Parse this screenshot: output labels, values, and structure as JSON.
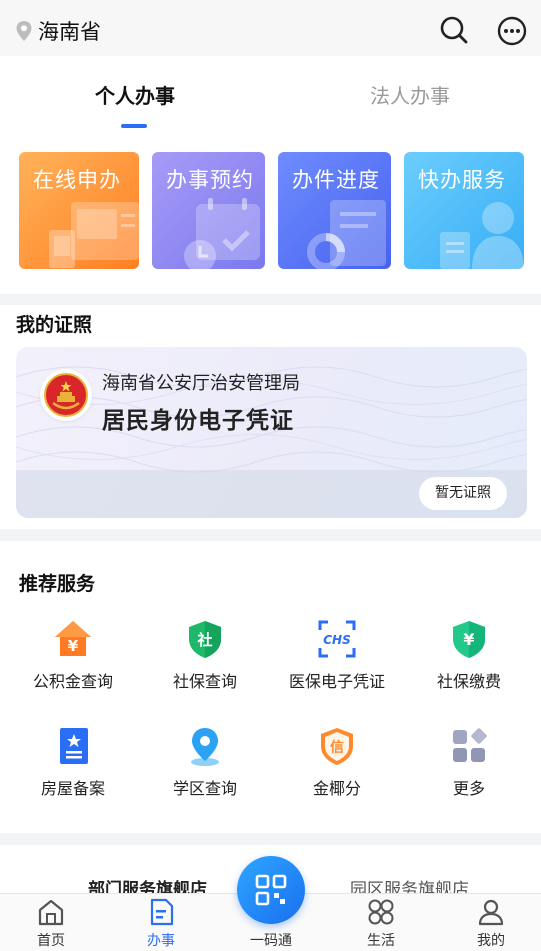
{
  "header": {
    "location": "海南省",
    "icons": {
      "location": "location-pin-icon",
      "search": "search-icon",
      "more": "more-icon"
    }
  },
  "tabs": [
    {
      "label": "个人办事",
      "active": true
    },
    {
      "label": "法人办事",
      "active": false
    }
  ],
  "quick_tiles": [
    {
      "label": "在线申办",
      "color": "#ff8a2b",
      "icon": "computer-icon"
    },
    {
      "label": "办事预约",
      "color": "#8a84f2",
      "icon": "calendar-clock-icon"
    },
    {
      "label": "办件进度",
      "color": "#5472f2",
      "icon": "document-progress-icon"
    },
    {
      "label": "快办服务",
      "color": "#45b6f7",
      "icon": "person-service-icon"
    }
  ],
  "certificates": {
    "title": "我的证照",
    "card": {
      "issuer": "海南省公安厅治安管理局",
      "name": "居民身份电子凭证",
      "status": "暂无证照",
      "icon": "national-emblem-icon"
    }
  },
  "recommended": {
    "title": "推荐服务",
    "items": [
      {
        "label": "公积金查询",
        "icon": "housing-fund-icon",
        "color": "#ff7a22"
      },
      {
        "label": "社保查询",
        "icon": "social-security-shield-icon",
        "color": "#1fb86b"
      },
      {
        "label": "医保电子凭证",
        "icon": "medical-insurance-icon",
        "color": "#2a6ef5"
      },
      {
        "label": "社保缴费",
        "icon": "social-security-payment-icon",
        "color": "#22c98a"
      },
      {
        "label": "房屋备案",
        "icon": "house-record-icon",
        "color": "#2a6ef5"
      },
      {
        "label": "学区查询",
        "icon": "school-district-pin-icon",
        "color": "#2ca2f5"
      },
      {
        "label": "金椰分",
        "icon": "credit-score-icon",
        "color": "#ff8a2b"
      },
      {
        "label": "更多",
        "icon": "more-grid-icon",
        "color": "#8f97b4"
      }
    ]
  },
  "flagship": {
    "left": "部门服务旗舰店",
    "right": "园区服务旗舰店"
  },
  "nav": {
    "items": [
      {
        "label": "首页",
        "icon": "home-icon",
        "active": false
      },
      {
        "label": "办事",
        "icon": "affairs-icon",
        "active": true
      },
      {
        "label": "一码通",
        "icon": "qr-code-icon",
        "active": false
      },
      {
        "label": "生活",
        "icon": "life-icon",
        "active": false
      },
      {
        "label": "我的",
        "icon": "profile-icon",
        "active": false
      }
    ]
  },
  "colors": {
    "accent": "#2a6ef5"
  }
}
